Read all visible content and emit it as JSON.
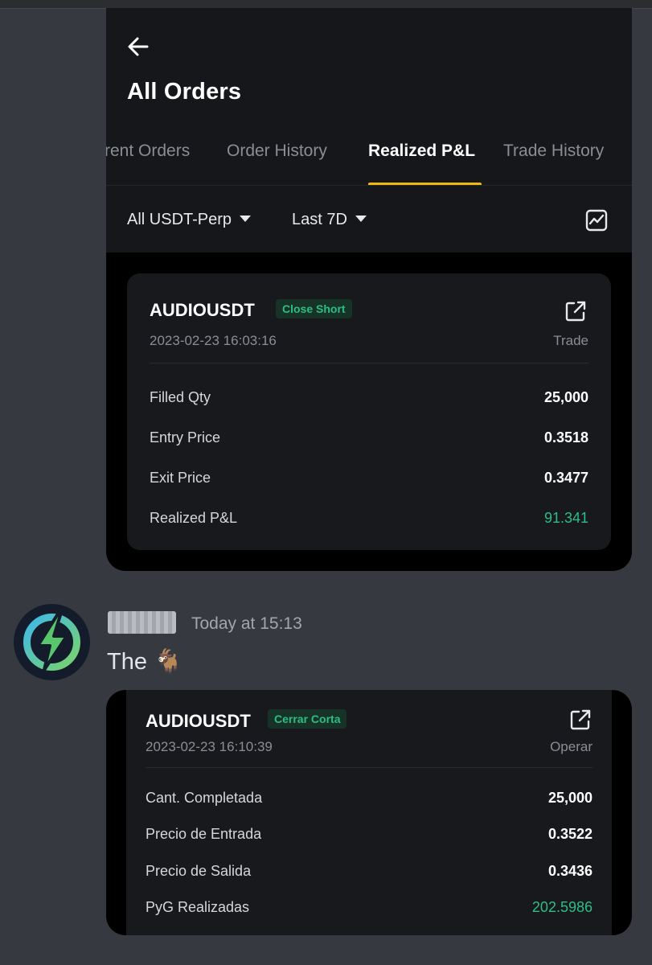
{
  "app": {
    "title": "All Orders",
    "tabs": [
      "rent Orders",
      "Order History",
      "Realized P&L",
      "Trade History"
    ],
    "active_tab": "Realized P&L",
    "filters": {
      "contract": "All USDT-Perp",
      "range": "Last 7D"
    }
  },
  "card1": {
    "symbol": "AUDIOUSDT",
    "tag": "Close Short",
    "timestamp": "2023-02-23 16:03:16",
    "trade_label": "Trade",
    "rows": [
      {
        "label": "Filled Qty",
        "value": "25,000"
      },
      {
        "label": "Entry Price",
        "value": "0.3518"
      },
      {
        "label": "Exit Price",
        "value": "0.3477"
      },
      {
        "label": "Realized P&L",
        "value": "91.341"
      }
    ]
  },
  "message": {
    "timestamp": "Today at 15:13",
    "text": "The 🐐"
  },
  "card2": {
    "symbol": "AUDIOUSDT",
    "tag": "Cerrar Corta",
    "timestamp": "2023-02-23 16:10:39",
    "trade_label": "Operar",
    "rows": [
      {
        "label": "Cant. Completada",
        "value": "25,000"
      },
      {
        "label": "Precio de Entrada",
        "value": "0.3522"
      },
      {
        "label": "Precio de Salida",
        "value": "0.3436"
      },
      {
        "label": "PyG Realizadas",
        "value": "202.5986"
      }
    ]
  },
  "colors": {
    "accent": "#f0b90b",
    "profit": "#2ebd85",
    "background": "#36393f"
  },
  "icons": [
    "back-arrow-icon",
    "chevron-down-icon",
    "chart-icon",
    "external-link-icon",
    "lightning-bolt-icon"
  ]
}
